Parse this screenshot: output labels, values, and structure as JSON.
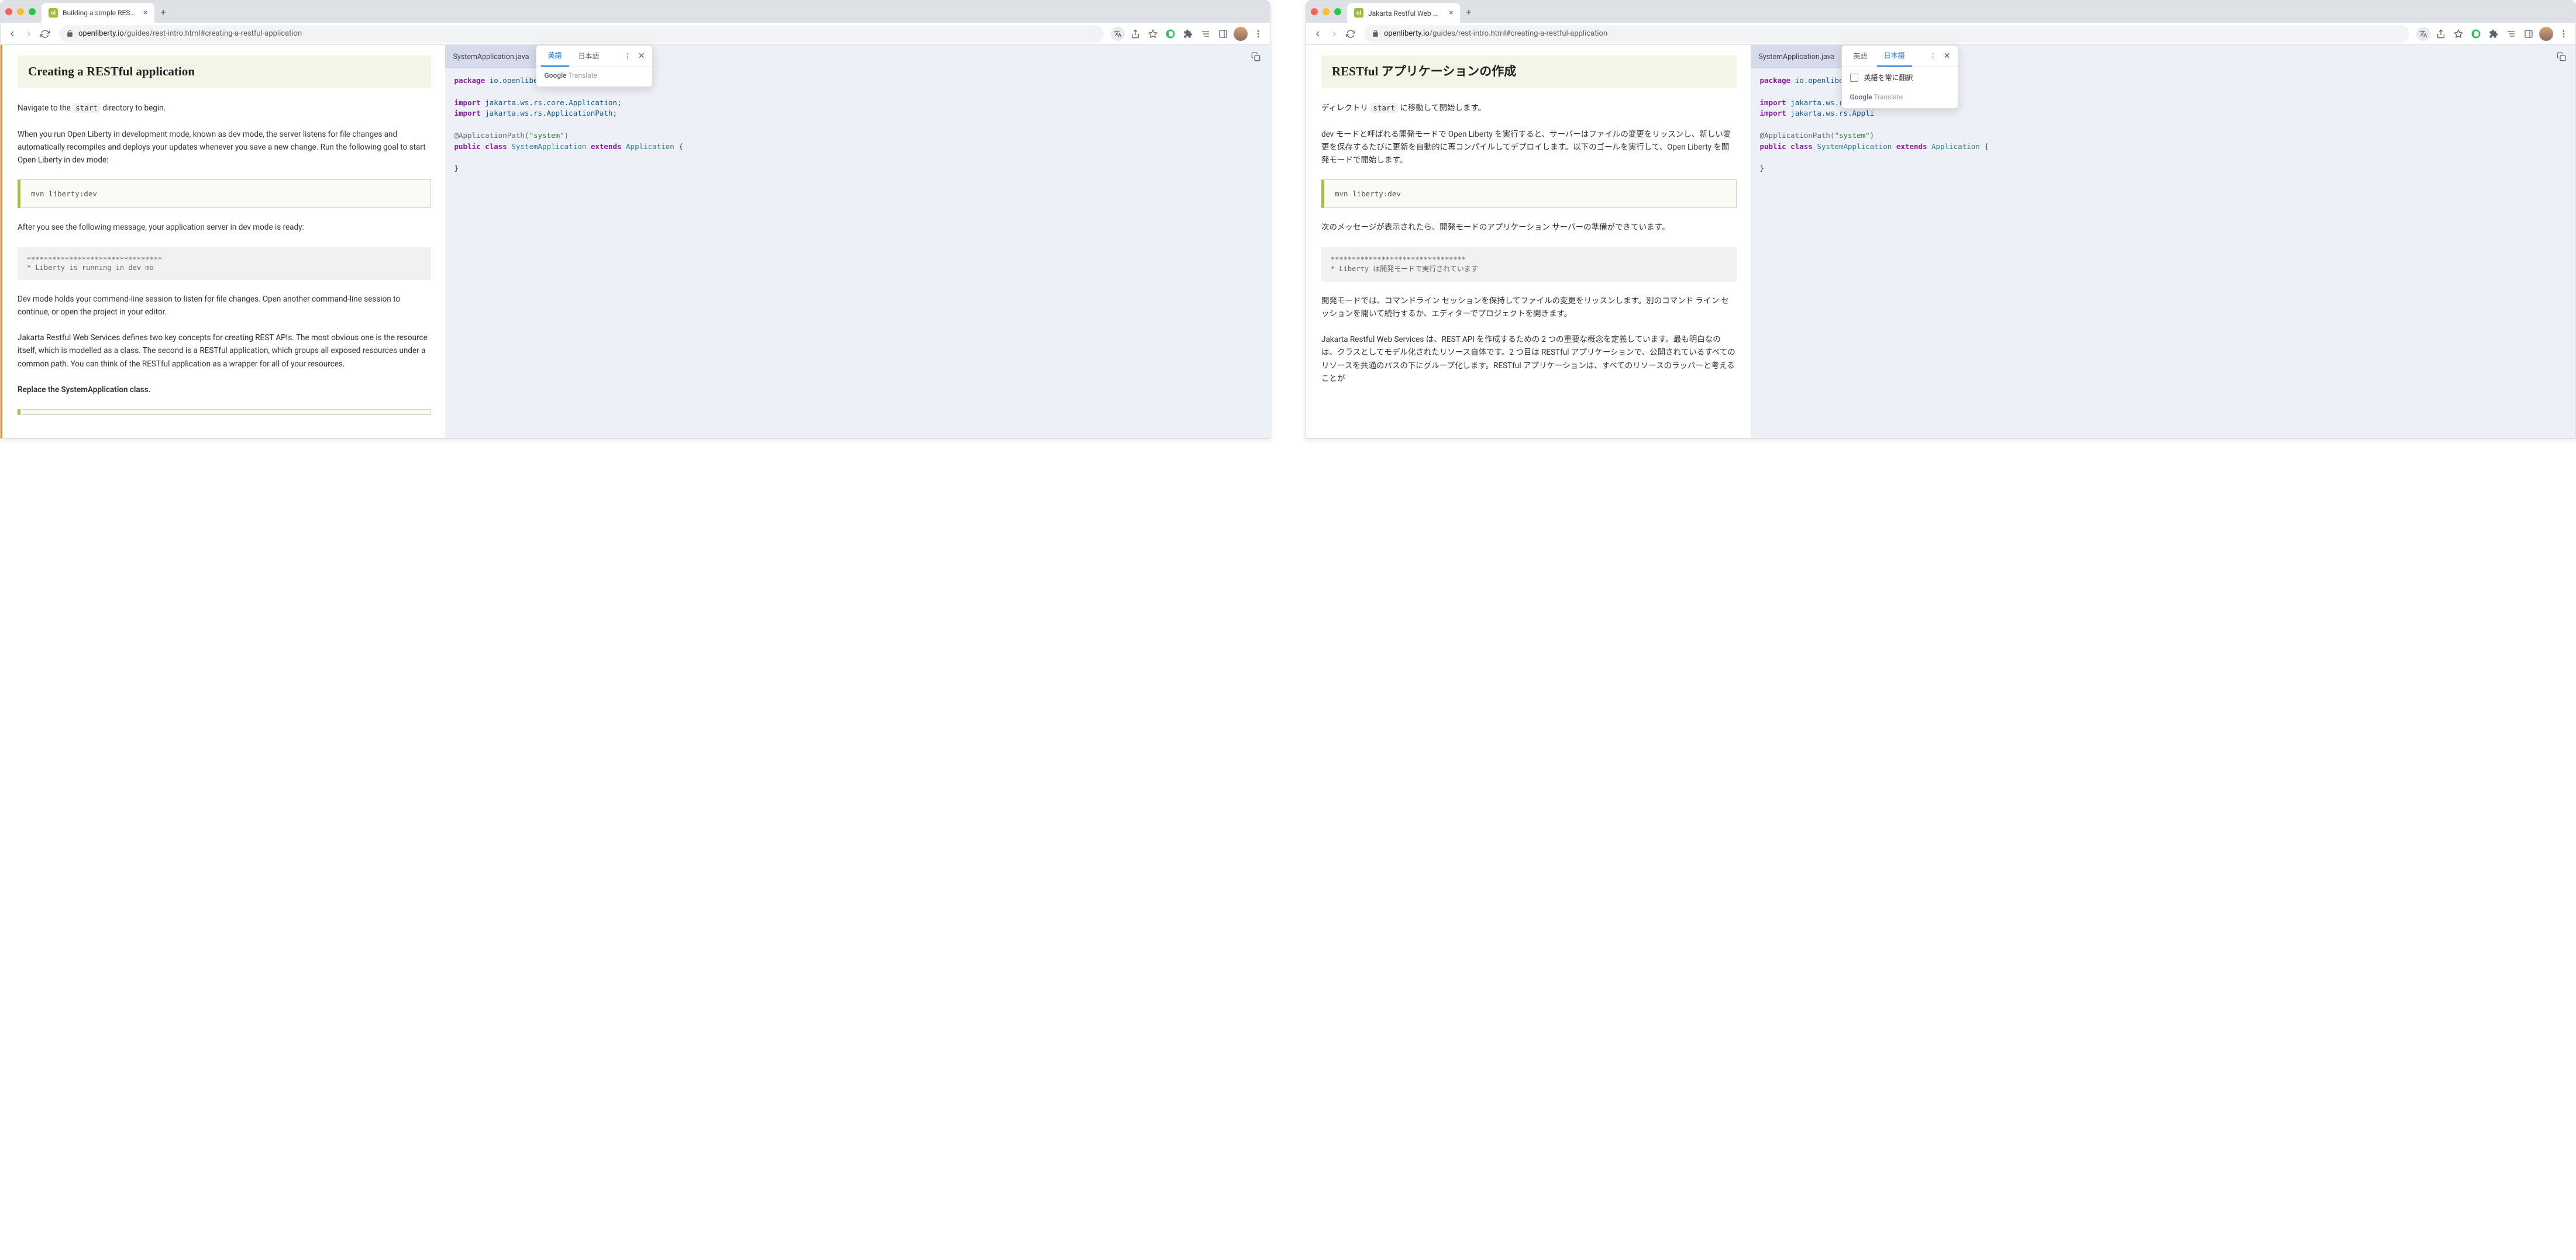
{
  "left": {
    "tab_title": "Building a simple RESTful Java",
    "url_domain": "openliberty.io",
    "url_path": "/guides/rest-intro.html#creating-a-restful-application",
    "heading": "Creating a RESTful application",
    "para1_pre": "Navigate to the ",
    "para1_code": "start",
    "para1_post": " directory to begin.",
    "para2": "When you run Open Liberty in development mode, known as dev mode, the server listens for file changes and automatically recompiles and deploys your updates whenever you save a new change. Run the following goal to start Open Liberty in dev mode:",
    "cmd": "mvn liberty:dev",
    "para3": "After you see the following message, your application server in dev mode is ready:",
    "log_line1": "********************************",
    "log_line2": "*    Liberty is running in dev mo",
    "para4": "Dev mode holds your command-line session to listen for file changes. Open another command-line session to continue, or open the project in your editor.",
    "para5": "Jakarta Restful Web Services defines two key concepts for creating REST APIs. The most obvious one is the resource itself, which is modelled as a class. The second is a RESTful application, which groups all exposed resources under a common path. You can think of the RESTful application as a wrapper for all of your resources.",
    "para6": "Replace the SystemApplication class.",
    "code_tab": "SystemApplication.java",
    "translate": {
      "tab1": "英語",
      "tab2": "日本語",
      "active": "tab1",
      "branding_g": "Google",
      "branding_t": "Translate"
    },
    "code": {
      "l1_kw": "package",
      "l1_pkg": "io.openliberty.g",
      "l2_kw": "import",
      "l2_pkg": "jakarta.ws.rs.core.Application",
      "l2_end": ";",
      "l3_kw": "import",
      "l3_pkg": "jakarta.ws.rs.ApplicationPath",
      "l3_end": ";",
      "l4_ann": "@ApplicationPath(",
      "l4_str": "\"system\"",
      "l4_ann2": ")",
      "l5_kw": "public class",
      "l5_cls": "SystemApplication",
      "l5_kw2": "extends",
      "l5_cls2": "Application",
      "l5_end": " {",
      "l6": "}"
    }
  },
  "right": {
    "tab_title": "Jakarta Restful Web サービス (",
    "url_domain": "openliberty.io",
    "url_path": "/guides/rest-intro.html#creating-a-restful-application",
    "heading": "RESTful アプリケーションの作成",
    "para1_pre": "ディレクトリ ",
    "para1_code": "start",
    "para1_post": " に移動して開始します。",
    "para2": "dev モードと呼ばれる開発モードで Open Liberty を実行すると、サーバーはファイルの変更をリッスンし、新しい変更を保存するたびに更新を自動的に再コンパイルしてデプロイします。以下のゴールを実行して、Open Liberty を開発モードで開始します。",
    "cmd": "mvn liberty:dev",
    "para3": "次のメッセージが表示されたら、開発モードのアプリケーション サーバーの準備ができています。",
    "log_line1": "********************************",
    "log_line2": "* Liberty は開発モードで実行されています",
    "para4": "開発モードでは、コマンドライン セッションを保持してファイルの変更をリッスンします。別のコマンド ライン セッションを開いて続行するか、エディターでプロジェクトを開きます。",
    "para5": "Jakarta Restful Web Services は、REST API を作成するための 2 つの重要な概念を定義しています。最も明白なのは、クラスとしてモデル化されたリソース自体です。2 つ目は RESTful アプリケーションで、公開されているすべてのリソースを共通のパスの下にグループ化します。RESTful アプリケーションは、すべてのリソースのラッパーと考えることが",
    "code_tab": "SystemApplication.java",
    "translate": {
      "tab1": "英語",
      "tab2": "日本語",
      "active": "tab2",
      "always_label": "英語を常に翻訳",
      "branding_g": "Google",
      "branding_t": "Translate"
    },
    "code": {
      "l1_kw": "package",
      "l1_pkg": "io.openliberty.g",
      "l2_kw": "import",
      "l2_pkg": "jakarta.ws.rs.cor",
      "l3_kw": "import",
      "l3_pkg": "jakarta.ws.rs.Appli",
      "l4_ann": "@ApplicationPath(",
      "l4_str": "\"system\"",
      "l4_ann2": ")",
      "l5_kw": "public class",
      "l5_cls": "SystemApplication",
      "l5_kw2": "extends",
      "l5_cls2": "Application",
      "l5_end": " {",
      "l6": "}"
    }
  }
}
